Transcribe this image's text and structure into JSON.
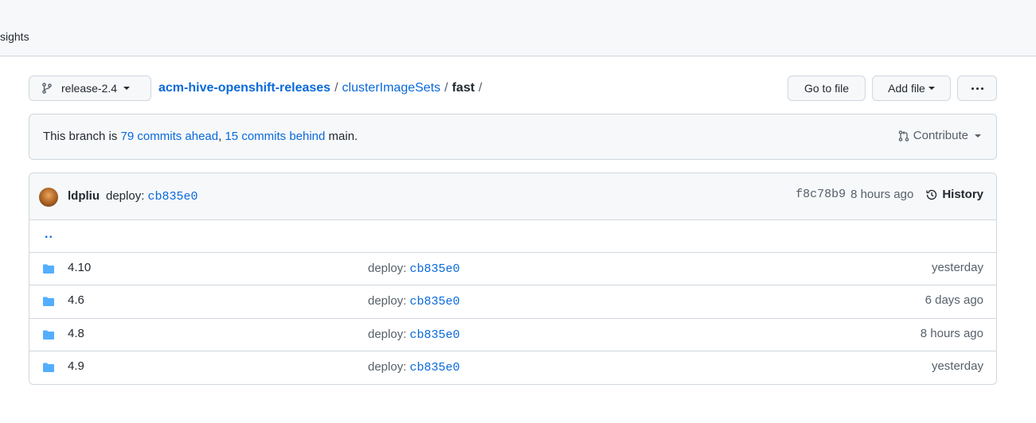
{
  "repo_nav": {
    "tab_insights": "sights"
  },
  "file_navigation": {
    "branch": "release-2.4",
    "breadcrumb": {
      "repo": "acm-hive-openshift-releases",
      "sep": "/",
      "folder": "clusterImageSets",
      "current": "fast"
    },
    "go_to_file": "Go to file",
    "add_file": "Add file"
  },
  "branch_info": {
    "prefix": "This branch is ",
    "ahead": "79 commits ahead",
    "comma": ", ",
    "behind": "15 commits behind",
    "suffix": " main.",
    "contribute": "Contribute"
  },
  "latest_commit": {
    "author": "ldpliu",
    "message": "deploy: ",
    "message_sha": "cb835e0",
    "sha": "f8c78b9",
    "time": "8 hours ago",
    "history_label": "History"
  },
  "files": {
    "parent": "..",
    "rows": [
      {
        "name": "4.10",
        "message": "deploy: ",
        "sha": "cb835e0",
        "age": "yesterday"
      },
      {
        "name": "4.6",
        "message": "deploy: ",
        "sha": "cb835e0",
        "age": "6 days ago"
      },
      {
        "name": "4.8",
        "message": "deploy: ",
        "sha": "cb835e0",
        "age": "8 hours ago"
      },
      {
        "name": "4.9",
        "message": "deploy: ",
        "sha": "cb835e0",
        "age": "yesterday"
      }
    ]
  },
  "colors": {
    "link": "#0969da",
    "folder_icon": "#54aeff",
    "border": "#d0d7de",
    "subtle_bg": "#f6f8fa"
  },
  "icons": {
    "branch": "git-branch-icon",
    "contribute": "git-pull-request-icon",
    "history": "history-icon",
    "folder": "folder-icon",
    "more": "kebab-horizontal-icon"
  }
}
